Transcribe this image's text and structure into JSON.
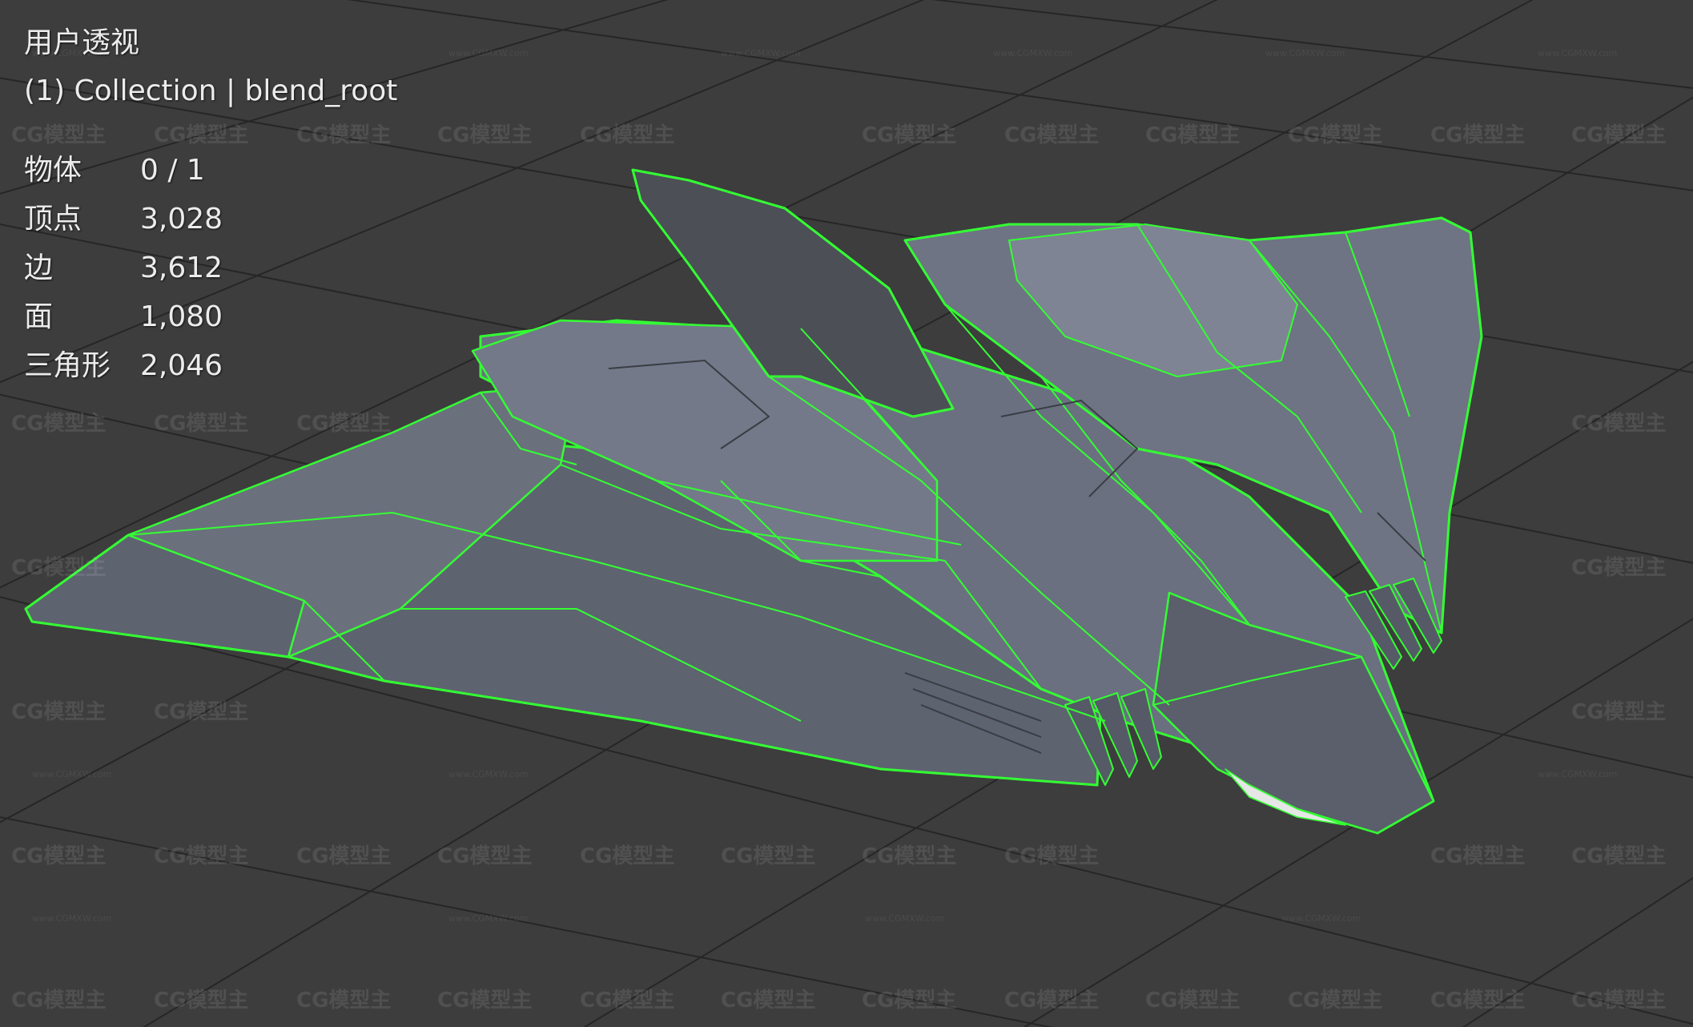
{
  "viewport": {
    "view_name": "用户透视",
    "collection_label": "(1) Collection | blend_root",
    "wireframe_color": "#33ff33",
    "background_color": "#3d3d3d"
  },
  "stats": [
    {
      "label": "物体",
      "value": "0 / 1"
    },
    {
      "label": "顶点",
      "value": "3,028"
    },
    {
      "label": "边",
      "value": "3,612"
    },
    {
      "label": "面",
      "value": "1,080"
    },
    {
      "label": "三角形",
      "value": "2,046"
    }
  ],
  "watermark": {
    "logo_text": "CG模型主",
    "url_text": "www.CGMXW.com"
  }
}
